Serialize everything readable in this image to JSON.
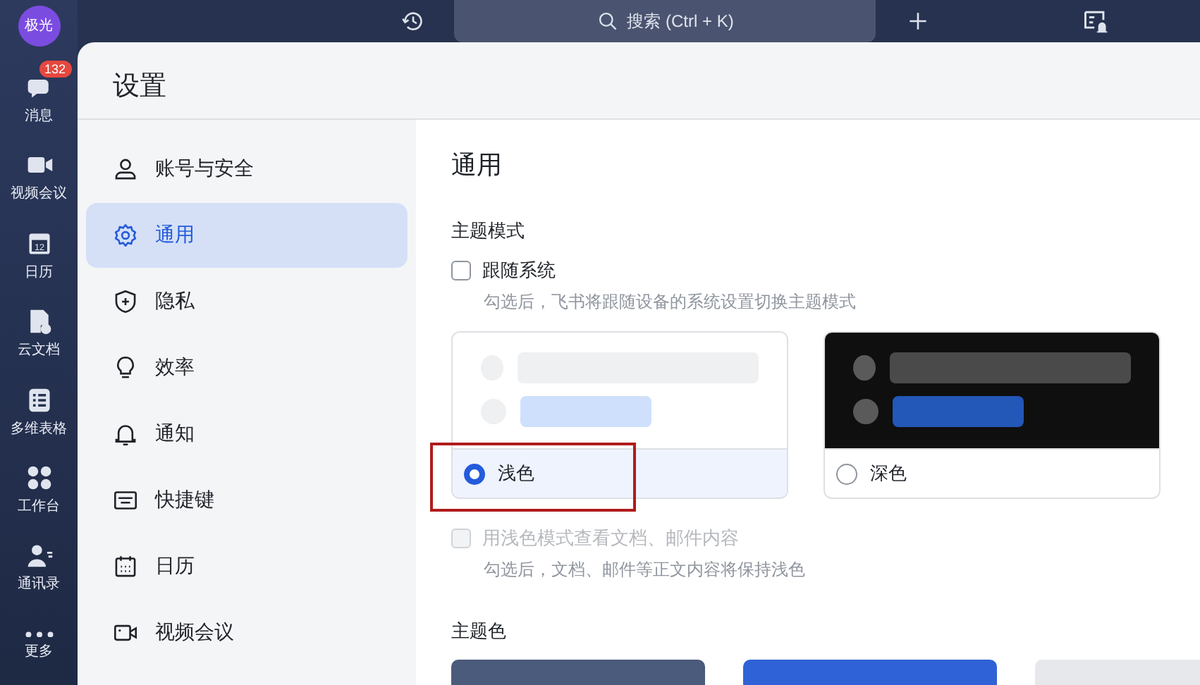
{
  "top_bar": {
    "avatar": "极光",
    "search": {
      "placeholder": "搜索 (Ctrl + K)"
    }
  },
  "rail": [
    {
      "label": "消息",
      "kind": "chat",
      "badge": "132"
    },
    {
      "label": "视频会议",
      "kind": "video"
    },
    {
      "label": "日历",
      "kind": "calendar",
      "date": "12"
    },
    {
      "label": "云文档",
      "kind": "doc"
    },
    {
      "label": "多维表格",
      "kind": "table"
    },
    {
      "label": "工作台",
      "kind": "apps"
    },
    {
      "label": "通讯录",
      "kind": "contacts"
    },
    {
      "label": "更多",
      "kind": "more"
    }
  ],
  "settings": {
    "title": "设置",
    "menu": [
      {
        "label": "账号与安全",
        "kind": "person",
        "selected": false
      },
      {
        "label": "通用",
        "kind": "gear",
        "selected": true
      },
      {
        "label": "隐私",
        "kind": "shield",
        "selected": false
      },
      {
        "label": "效率",
        "kind": "bulb",
        "selected": false
      },
      {
        "label": "通知",
        "kind": "bell",
        "selected": false
      },
      {
        "label": "快捷键",
        "kind": "keyboard",
        "selected": false
      },
      {
        "label": "日历",
        "kind": "calendar",
        "selected": false
      },
      {
        "label": "视频会议",
        "kind": "video",
        "selected": false
      }
    ]
  },
  "general": {
    "heading": "通用",
    "theme_mode": {
      "label": "主题模式",
      "follow_system": {
        "label": "跟随系统",
        "checked": false,
        "disabled": false,
        "hint": "勾选后，飞书将跟随设备的系统设置切换主题模式"
      },
      "options": [
        {
          "label": "浅色",
          "kind": "light",
          "selected": true
        },
        {
          "label": "深色",
          "kind": "dark",
          "selected": false
        }
      ],
      "light_docs": {
        "label": "用浅色模式查看文档、邮件内容",
        "checked": false,
        "disabled": true,
        "hint": "勾选后，文档、邮件等正文内容将保持浅色"
      }
    },
    "theme_color": {
      "label": "主题色",
      "swatches": [
        {
          "color": "#4b5b7c"
        },
        {
          "color": "#2f62d6"
        },
        {
          "color": "#e6e8eb"
        }
      ]
    }
  }
}
